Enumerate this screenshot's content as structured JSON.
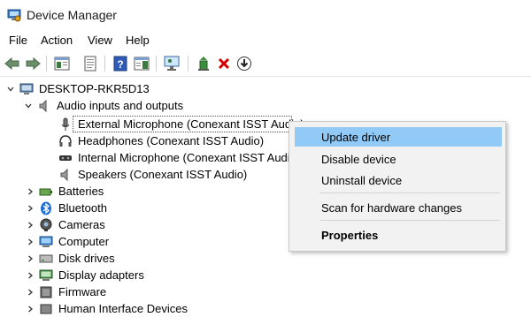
{
  "window": {
    "title": "Device Manager",
    "app_icon": "device-manager-icon"
  },
  "menu": {
    "items": [
      "File",
      "Action",
      "View",
      "Help"
    ]
  },
  "toolbar": {
    "buttons": [
      "back-icon",
      "forward-icon",
      "console-tree-icon",
      "properties-icon",
      "help-icon",
      "action-pane-icon",
      "scan-monitor-icon",
      "update-driver-icon",
      "uninstall-icon",
      "download-icon"
    ]
  },
  "tree": {
    "root": "DESKTOP-RKR5D13",
    "audio_category": "Audio inputs and outputs",
    "audio_children": [
      "External Microphone (Conexant ISST Audio)",
      "Headphones (Conexant ISST Audio)",
      "Internal Microphone (Conexant ISST Audio)",
      "Speakers (Conexant ISST Audio)"
    ],
    "categories": [
      "Batteries",
      "Bluetooth",
      "Cameras",
      "Computer",
      "Disk drives",
      "Display adapters",
      "Firmware",
      "Human Interface Devices"
    ]
  },
  "context_menu": {
    "items": [
      "Update driver",
      "Disable device",
      "Uninstall device",
      "Scan for hardware changes",
      "Properties"
    ],
    "highlighted": "Update driver",
    "default_item": "Properties"
  },
  "colors": {
    "highlight": "#91c9f7",
    "menu_bg": "#f2f2f2",
    "accent_red": "#d40000"
  }
}
